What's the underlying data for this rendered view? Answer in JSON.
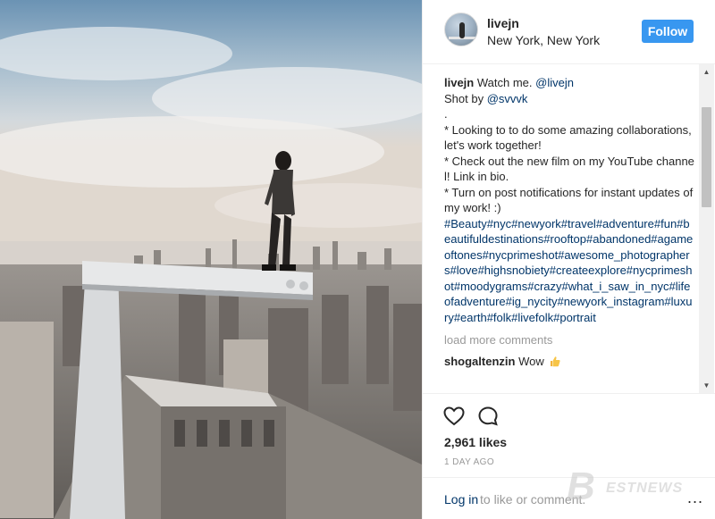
{
  "post": {
    "image_alt": "Man standing on a crane beam high above the New York City skyline",
    "username": "livejn",
    "location": "New York, New York",
    "follow_label": "Follow"
  },
  "caption": {
    "user": "livejn",
    "text_prefix": "Watch me. ",
    "mention_self": "@livejn",
    "shot_by_prefix": "Shot by ",
    "mention_shooter": "@svvvk",
    "dot": ".",
    "bullet_1": "* Looking to to do some amazing collaborations, let's work together!",
    "bullet_2": "* Check out the new film on my YouTube channel! Link in bio.",
    "bullet_3": "* Turn on post notifications for instant updates of my work! :)",
    "hashtags": "#Beauty#nyc#newyork#travel#adventure#fun#beautifuldestinations#rooftop#abandoned#agameoftones#nycprimeshot#awesome_photographers#love#highsnobiety#createexplore#nycprimeshot#moodygrams#crazy#what_i_saw_in_nyc#lifeofadventure#ig_nycity#newyork_instagram#luxury#earth#folk#livefolk#portrait"
  },
  "comments": {
    "load_more": "load more comments",
    "items": [
      {
        "user": "shogaltenzin",
        "text": "Wow"
      }
    ]
  },
  "actions": {
    "like_icon": "heart-icon",
    "comment_icon": "comment-icon",
    "likes": "2,961 likes",
    "timestamp": "1 DAY AGO",
    "login_link": "Log in",
    "login_text": "to like or comment.",
    "more_icon": "..."
  },
  "watermark": {
    "letter": "B",
    "text": "ESTNEWS"
  },
  "colors": {
    "follow_button": "#3897f0",
    "link": "#003569",
    "muted": "#999999",
    "text": "#262626"
  }
}
